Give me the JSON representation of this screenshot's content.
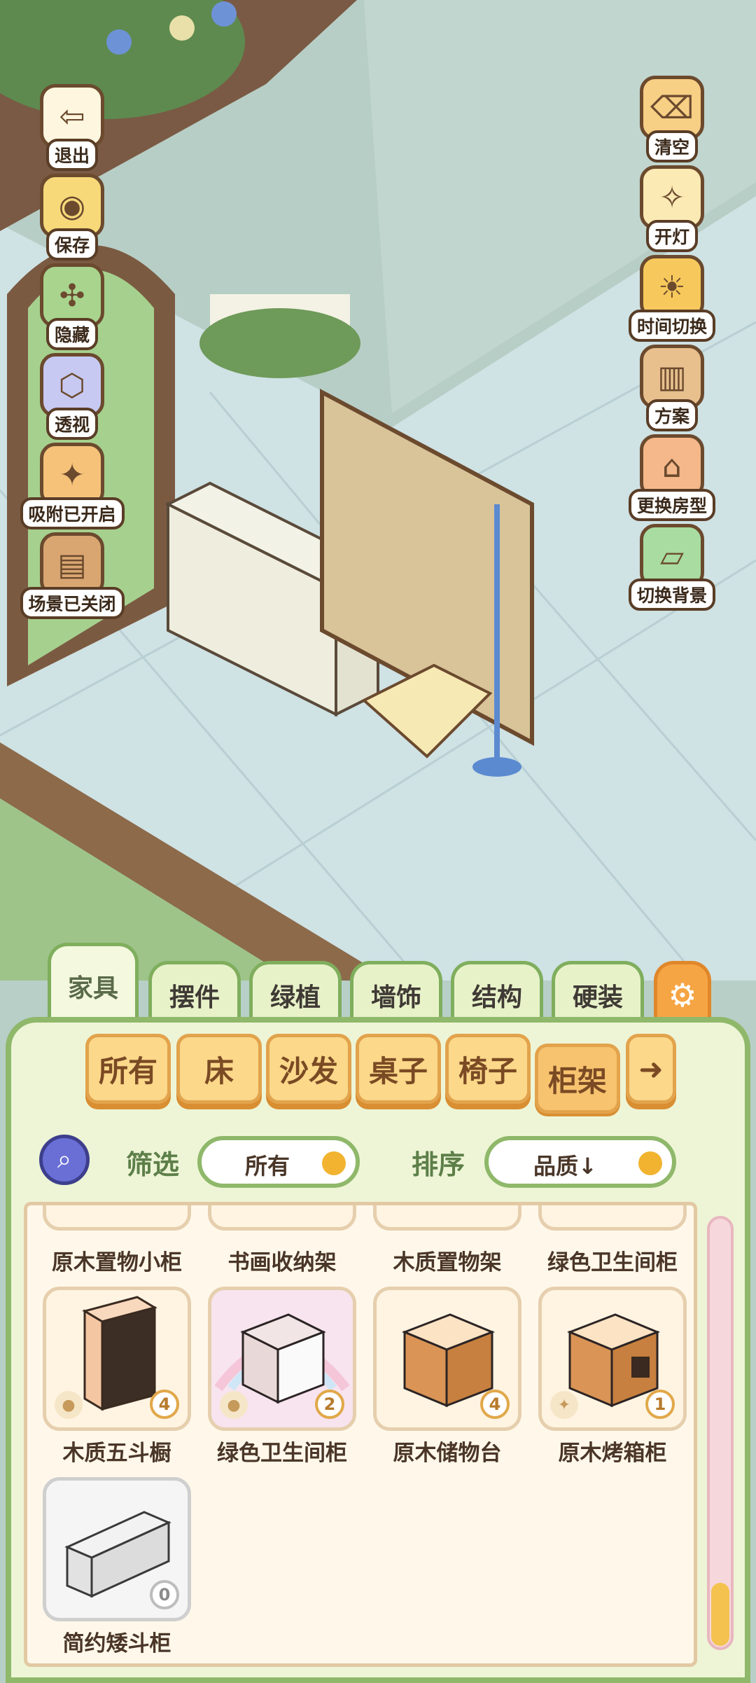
{
  "side_left": [
    {
      "label": "退出",
      "icon": "exit-door-icon"
    },
    {
      "label": "保存",
      "icon": "duck-save-icon"
    },
    {
      "label": "隐藏",
      "icon": "hide-icon"
    },
    {
      "label": "透视",
      "icon": "perspective-cube-icon"
    },
    {
      "label": "吸附已开启",
      "icon": "snap-icon"
    },
    {
      "label": "场景已关闭",
      "icon": "scene-icon"
    }
  ],
  "side_right": [
    {
      "label": "清空",
      "icon": "clear-icon"
    },
    {
      "label": "开灯",
      "icon": "light-icon"
    },
    {
      "label": "时间切换",
      "icon": "sun-moon-icon"
    },
    {
      "label": "方案",
      "icon": "plan-icon"
    },
    {
      "label": "更换房型",
      "icon": "house-icon"
    },
    {
      "label": "切换背景",
      "icon": "background-icon"
    }
  ],
  "category_tabs": [
    "家具",
    "摆件",
    "绿植",
    "墙饰",
    "结构",
    "硬装"
  ],
  "sub_tabs": [
    "所有",
    "床",
    "沙发",
    "桌子",
    "椅子",
    "柜架"
  ],
  "filter": {
    "label": "筛选",
    "value": "所有"
  },
  "sort": {
    "label": "排序",
    "value": "品质↓"
  },
  "top_row_names": [
    "原木置物小柜",
    "书画收纳架",
    "木质置物架",
    "绿色卫生间柜"
  ],
  "items": [
    {
      "name": "木质五斗橱",
      "count": "4",
      "color": "#f4c6a2"
    },
    {
      "name": "绿色卫生间柜",
      "count": "2",
      "color": "#e9d8d8"
    },
    {
      "name": "原木储物台",
      "count": "4",
      "color": "#d99456"
    },
    {
      "name": "原木烤箱柜",
      "count": "1",
      "color": "#d99456"
    },
    {
      "name": "简约矮斗柜",
      "count": "0",
      "color": "#f2f2f2"
    }
  ]
}
